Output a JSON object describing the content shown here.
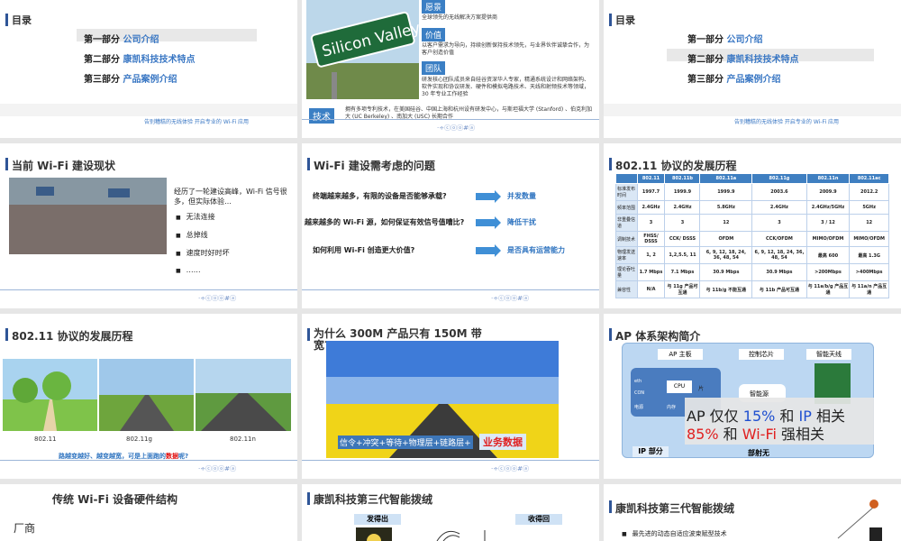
{
  "footer": {
    "slogan": "告别糟糕的无线体验 开启专业的 Wi-Fi 应用",
    "mark": "·÷ⓒⓞⓞ#ⓐ"
  },
  "toc": {
    "title": "目录",
    "rows": [
      {
        "part": "第一部分",
        "name": "公司介绍"
      },
      {
        "part": "第二部分",
        "name": "康凯科技技术特点"
      },
      {
        "part": "第三部分",
        "name": "产品案例介绍"
      }
    ]
  },
  "company": {
    "sign": "Silicon Valley",
    "vision_label": "愿景",
    "vision_text": "全球领先的无线解决方案提供商",
    "value_label": "价值",
    "value_text": "以客户需求为导向，持续创新保持技术领先，与业界伙伴诚挚合作，为客户创造价值",
    "team_label": "团队",
    "team_text": "研发核心团队成员来自硅谷资深华人专家，精通系统设计和网络架构、软件实现和协议研发、硬件和模拟电路技术、天线和射频技术等领域， 30 年专业工作经验",
    "tech_label": "技术",
    "tech_text": "拥有多项专利技术，在美国硅谷、中国上海和杭州设有研发中心，与斯坦福大学 (Stanford) 、伯克利加大 (UC Berkeley) 、南加大 (USC) 长期合作"
  },
  "status": {
    "title": "当前 Wi-Fi 建设现状",
    "intro": "经历了一轮建设高峰，Wi-Fi 信号很多，但实际体验…",
    "bullets": [
      "无法连接",
      "总掉线",
      "速度时好时坏",
      "……"
    ]
  },
  "issues": {
    "title": "Wi-Fi 建设需考虑的问题",
    "rows": [
      {
        "q": "终端越来越多，有限的设备是否能够承载?",
        "a": "并发数量"
      },
      {
        "q": "越来越多的 Wi-Fi 源，如何保证有效信号值嘈比?",
        "a": "降低干扰"
      },
      {
        "q": "如何利用 Wi-Fi 创造更大价值?",
        "a": "是否具有运营能力"
      }
    ]
  },
  "protocol": {
    "title": "802.11 协议的发展历程",
    "headers": [
      "",
      "802.11",
      "802.11b",
      "802.11a",
      "802.11g",
      "802.11n",
      "802.11ac"
    ],
    "rows": [
      [
        "标准发布时间",
        "1997.7",
        "1999.9",
        "1999.9",
        "2003.6",
        "2009.9",
        "2012.2"
      ],
      [
        "频率范围",
        "2.4GHz",
        "2.4GHz",
        "5.8GHz",
        "2.4GHz",
        "2.4GHz/5GHz",
        "5GHz"
      ],
      [
        "非重叠信道",
        "3",
        "3",
        "12",
        "3",
        "3 / 12",
        "12"
      ],
      [
        "调制技术",
        "FHSS/ DSSS",
        "CCK/ DSSS",
        "OFDM",
        "CCK/OFDM",
        "MIMO/OFDM",
        "MIMO/OFDM"
      ],
      [
        "物理发送速率",
        "1, 2",
        "1,2,5.5, 11",
        "6, 9, 12, 18, 24, 36, 48, 54",
        "6, 9, 12, 18, 24, 36, 48, 54",
        "最高 600",
        "最高 1.3G"
      ],
      [
        "理论吞吐量",
        "1.7 Mbps",
        "7.1 Mbps",
        "30.9 Mbps",
        "30.9 Mbps",
        ">200Mbps",
        ">400Mbps"
      ],
      [
        "兼容性",
        "N/A",
        "与 11g 产品可互通",
        "与 11b/g 不能互通",
        "与 11b 产品可互通",
        "与 11a/b/g 产品互通",
        "与 11a/n 产品互通"
      ]
    ]
  },
  "roads": {
    "title": "802.11 协议的发展历程",
    "labels": [
      "802.11",
      "802.11g",
      "802.11n"
    ],
    "caption_prefix": "路越变越好、越变越宽，可是上面跑的",
    "caption_emph": "数据",
    "caption_suffix": "呢?"
  },
  "why": {
    "title": "为什么 300M 产品只有 150M 带宽?",
    "overlay": "信令+冲突+等待+物理层+链路层+",
    "emph": "业务数据"
  },
  "ap": {
    "title": "AP 体系架构简介",
    "main_board": "AP 主板",
    "control_chip": "控制芯片",
    "smart_antenna": "智能天线",
    "cpu": "CPU",
    "eth": "eth",
    "con": "CON",
    "power": "电源",
    "memory": "内存",
    "chip": "片",
    "smart": "智能源",
    "ip_part": "IP 部分",
    "rf_part": "部射无",
    "line1_a": "AP 仅仅 ",
    "line1_b": "15%",
    "line1_c": " 和 ",
    "line1_d": "IP",
    "line1_e": " 相关",
    "line2_a": "85%",
    "line2_b": " 和 ",
    "line2_c": "Wi-Fi",
    "line2_d": " 强相关"
  },
  "hw": {
    "title": "传统 Wi-Fi 设备硬件结构",
    "vendor": "厂商"
  },
  "gen3a": {
    "title": "康凯科技第三代智能拨绒",
    "send": "发得出",
    "recv": "收得回"
  },
  "gen3b": {
    "title": "康凯科技第三代智能拨绒",
    "bullet": "最先进的动态自适应波束赋型技术"
  }
}
